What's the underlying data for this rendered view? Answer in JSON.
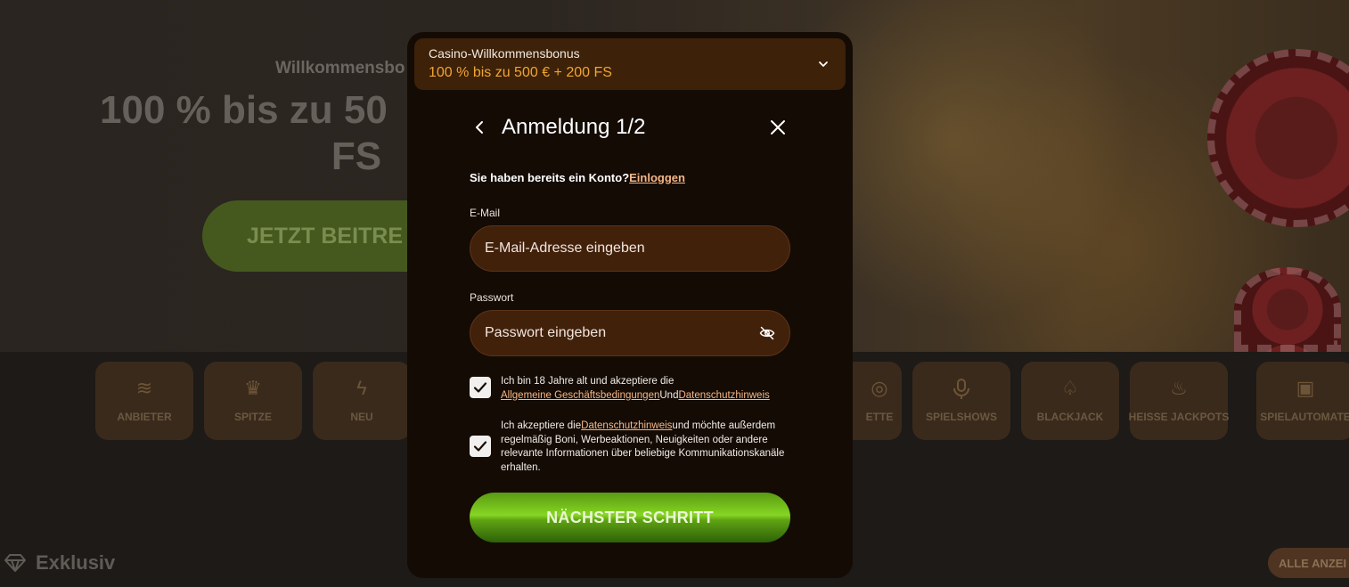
{
  "background": {
    "hero": {
      "subtitle": "Willkommensbo",
      "headline": "100 % bis zu 50",
      "headline_line2": "FS",
      "join_button": "JETZT BEITRE"
    },
    "categories": [
      {
        "label": "ANBIETER",
        "icon": "layers-icon",
        "glyph": "≋"
      },
      {
        "label": "SPITZE",
        "icon": "crown-icon",
        "glyph": "♛"
      },
      {
        "label": "NEU",
        "icon": "lightning-icon",
        "glyph": "ϟ"
      },
      {
        "label": "ETTE",
        "icon": "roulette-icon",
        "glyph": "◎"
      },
      {
        "label": "SPIELSHOWS",
        "icon": "microphone-icon",
        "glyph": "🎤"
      },
      {
        "label": "BLACKJACK",
        "icon": "spade-icon",
        "glyph": "♤"
      },
      {
        "label": "HEISSE JACKPOTS",
        "icon": "fire-icon",
        "glyph": "♨"
      },
      {
        "label": "SPIELAUTOMATE",
        "icon": "slot-machine-icon",
        "glyph": "▣"
      }
    ],
    "exklusiv": "Exklusiv",
    "alle_button": "ALLE ANZEI"
  },
  "modal": {
    "bonus": {
      "title": "Casino-Willkommensbonus",
      "offer": "100 % bis zu 500 € + 200 FS"
    },
    "header": {
      "title": "Anmeldung 1/2"
    },
    "login_prompt": {
      "text": "Sie haben bereits ein Konto?",
      "link": "Einloggen"
    },
    "email": {
      "label": "E-Mail",
      "placeholder": "E-Mail-Adresse eingeben",
      "value": ""
    },
    "password": {
      "label": "Passwort",
      "placeholder": "Passwort eingeben",
      "value": ""
    },
    "consent_age": {
      "checked": true,
      "text": "Ich bin 18 Jahre alt und akzeptiere die",
      "link1": "Allgemeine Geschäftsbedingungen",
      "joiner": "Und",
      "link2": "Datenschutzhinweis"
    },
    "consent_marketing": {
      "checked": true,
      "text_before": "Ich akzeptiere die",
      "link": "Datenschutzhinweis",
      "text_after": "und möchte außerdem regelmäßig Boni, Werbeaktionen, Neuigkeiten oder andere relevante Informationen über beliebige Kommunikationskanäle erhalten."
    },
    "next_button": "NÄCHSTER SCHRITT"
  },
  "colors": {
    "modal_bg": "#140b05",
    "field_bg": "#42210b",
    "bonus_bg": "#3d2108",
    "accent_orange": "#f0a534",
    "link": "#f6b786",
    "cta_green": "#86d623"
  }
}
